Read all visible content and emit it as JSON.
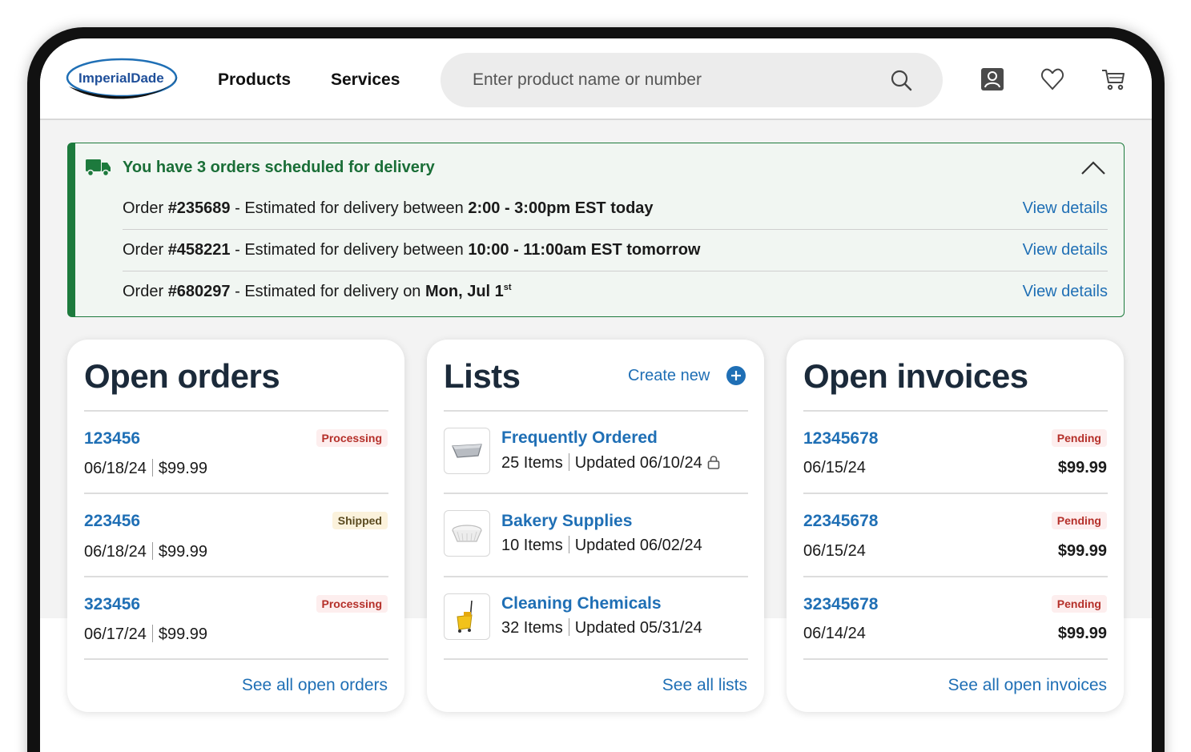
{
  "header": {
    "logo_text": "ImperialDade",
    "nav": [
      "Products",
      "Services"
    ],
    "search_placeholder": "Enter product name or number",
    "icons": [
      "account-icon",
      "heart-icon",
      "cart-icon"
    ]
  },
  "delivery": {
    "title": "You have 3 orders scheduled for delivery",
    "orders": [
      {
        "prefix": "Order ",
        "number": "#235689",
        "middle": " - Estimated for delivery between ",
        "when": "2:00 - 3:00pm EST today",
        "sup": "",
        "link": "View details"
      },
      {
        "prefix": "Order ",
        "number": "#458221",
        "middle": " - Estimated for delivery between ",
        "when": "10:00 - 11:00am EST tomorrow",
        "sup": "",
        "link": "View details"
      },
      {
        "prefix": "Order ",
        "number": "#680297",
        "middle": " - Estimated for delivery on ",
        "when": "Mon, Jul 1",
        "sup": "st",
        "link": "View details"
      }
    ]
  },
  "open_orders": {
    "title": "Open orders",
    "rows": [
      {
        "id": "123456",
        "status": "Processing",
        "date": "06/18/24",
        "amount": "$99.99"
      },
      {
        "id": "223456",
        "status": "Shipped",
        "date": "06/18/24",
        "amount": "$99.99"
      },
      {
        "id": "323456",
        "status": "Processing",
        "date": "06/17/24",
        "amount": "$99.99"
      }
    ],
    "footer": "See all open orders"
  },
  "lists": {
    "title": "Lists",
    "create_new": "Create new",
    "rows": [
      {
        "name": "Frequently Ordered",
        "items": "25 Items",
        "updated": "Updated 06/10/24",
        "icon": "foil-pan-icon",
        "locked": true
      },
      {
        "name": "Bakery Supplies",
        "items": "10 Items",
        "updated": "Updated 06/02/24",
        "icon": "baking-cup-icon",
        "locked": false
      },
      {
        "name": "Cleaning Chemicals",
        "items": "32 Items",
        "updated": "Updated 05/31/24",
        "icon": "mop-bucket-icon",
        "locked": false
      }
    ],
    "footer": "See all lists"
  },
  "open_invoices": {
    "title": "Open invoices",
    "rows": [
      {
        "id": "12345678",
        "status": "Pending",
        "date": "06/15/24",
        "amount": "$99.99"
      },
      {
        "id": "22345678",
        "status": "Pending",
        "date": "06/15/24",
        "amount": "$99.99"
      },
      {
        "id": "32345678",
        "status": "Pending",
        "date": "06/14/24",
        "amount": "$99.99"
      }
    ],
    "footer": "See all open invoices"
  },
  "colors": {
    "brand_blue": "#1f6fb5",
    "delivery_green": "#1d7a3d",
    "status_red": "#b5302a",
    "title_navy": "#1b2a3a"
  }
}
